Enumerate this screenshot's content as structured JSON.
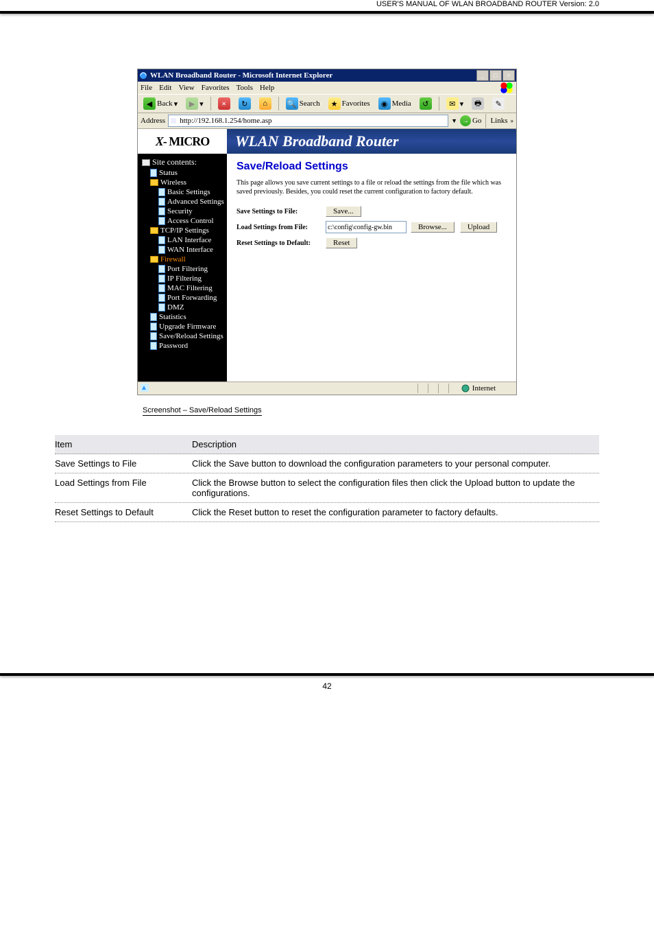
{
  "doc_header": "USER'S MANUAL OF WLAN BROADBAND ROUTER    Version: 2.0",
  "browser": {
    "title": "WLAN Broadband Router - Microsoft Internet Explorer",
    "menus": [
      "File",
      "Edit",
      "View",
      "Favorites",
      "Tools",
      "Help"
    ],
    "back": "Back",
    "search": "Search",
    "favorites": "Favorites",
    "media": "Media",
    "address_label": "Address",
    "address_value": "http://192.168.1.254/home.asp",
    "go": "Go",
    "links": "Links",
    "status_zone": "Internet"
  },
  "logo": {
    "x": "X",
    "rest": "- MICRO"
  },
  "banner_title": "WLAN Broadband Router",
  "tree": {
    "root": "Site contents:",
    "items": [
      {
        "label": "Status",
        "lvl": "sub",
        "ico": "p"
      },
      {
        "label": "Wireless",
        "lvl": "sub",
        "ico": "f"
      },
      {
        "label": "Basic Settings",
        "lvl": "sub2",
        "ico": "p"
      },
      {
        "label": "Advanced Settings",
        "lvl": "sub2",
        "ico": "p"
      },
      {
        "label": "Security",
        "lvl": "sub2",
        "ico": "p"
      },
      {
        "label": "Access Control",
        "lvl": "sub2",
        "ico": "p"
      },
      {
        "label": "TCP/IP Settings",
        "lvl": "sub",
        "ico": "f"
      },
      {
        "label": "LAN Interface",
        "lvl": "sub2",
        "ico": "p"
      },
      {
        "label": "WAN Interface",
        "lvl": "sub2",
        "ico": "p"
      },
      {
        "label": "Firewall",
        "lvl": "sub",
        "ico": "f",
        "hl": true
      },
      {
        "label": "Port Filtering",
        "lvl": "sub2",
        "ico": "p"
      },
      {
        "label": "IP Filtering",
        "lvl": "sub2",
        "ico": "p"
      },
      {
        "label": "MAC Filtering",
        "lvl": "sub2",
        "ico": "p"
      },
      {
        "label": "Port Forwarding",
        "lvl": "sub2",
        "ico": "p"
      },
      {
        "label": "DMZ",
        "lvl": "sub2",
        "ico": "p"
      },
      {
        "label": "Statistics",
        "lvl": "sub",
        "ico": "p"
      },
      {
        "label": "Upgrade Firmware",
        "lvl": "sub",
        "ico": "p"
      },
      {
        "label": "Save/Reload Settings",
        "lvl": "sub",
        "ico": "p"
      },
      {
        "label": "Password",
        "lvl": "sub",
        "ico": "p"
      }
    ]
  },
  "page": {
    "title": "Save/Reload Settings",
    "desc": "This page allows you save current settings to a file or reload the settings from the file which was saved previously. Besides, you could reset the current configuration to factory default.",
    "row1_label": "Save Settings to File:",
    "row1_btn": "Save...",
    "row2_label": "Load Settings from File:",
    "row2_value": "c:\\config\\config-gw.bin",
    "row2_browse": "Browse...",
    "row2_upload": "Upload",
    "row3_label": "Reset Settings to Default:",
    "row3_btn": "Reset"
  },
  "caption_no": "Screenshot – ",
  "caption_txt": "Save/Reload Settings",
  "table": {
    "h1": "Item",
    "h2": "Description",
    "r1a": "Save Settings to File",
    "r1b": "Click the Save button to download the configuration parameters to your personal computer.",
    "r2a": "Load Settings from File",
    "r2b": "Click the Browse button to select the configuration files then click the Upload button to update the configurations.",
    "r3a": "Reset Settings to Default",
    "r3b": "Click the Reset button to reset the configuration parameter to factory defaults."
  },
  "page_number": "42"
}
